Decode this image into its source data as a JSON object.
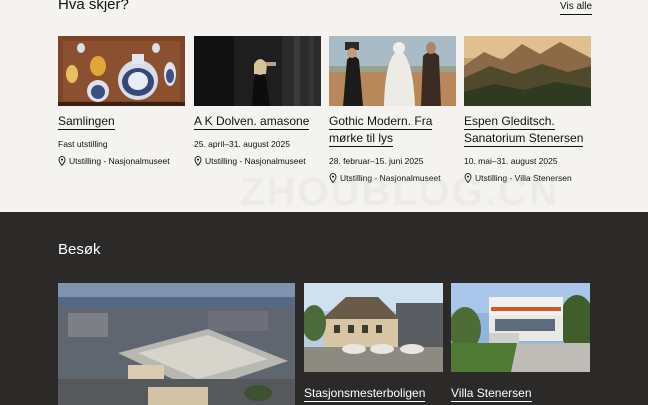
{
  "whats_on": {
    "title": "Hva skjer?",
    "see_all": "Vis alle",
    "cards": [
      {
        "title": "Samlingen",
        "date": "Fast utstilling",
        "location": "Utstilling - Nasjonalmuseet"
      },
      {
        "title": "A K Dolven. amasone",
        "date": "25. april–31. august 2025",
        "location": "Utstilling - Nasjonalmuseet"
      },
      {
        "title_line1": "Gothic Modern. Fra",
        "title_line2": "mørke til lys",
        "date": "28. februar–15. juni 2025",
        "location": "Utstilling - Nasjonalmuseet"
      },
      {
        "title_line1": "Espen Gleditsch.",
        "title_line2": "Sanatorium Stenersen",
        "date": "10. mai–31. august 2025",
        "location": "Utstilling - Villa Stenersen"
      }
    ]
  },
  "visit": {
    "title": "Besøk",
    "places": [
      {
        "label": ""
      },
      {
        "label": "Stasjonsmesterboligen"
      },
      {
        "label": "Villa Stenersen"
      }
    ]
  },
  "watermark": "ZHOUBLOG.CN",
  "icons": {
    "location": "map-pin-icon"
  },
  "colors": {
    "top_bg": "#f4f3f0",
    "bottom_bg": "#2b2a29",
    "text": "#111111"
  }
}
